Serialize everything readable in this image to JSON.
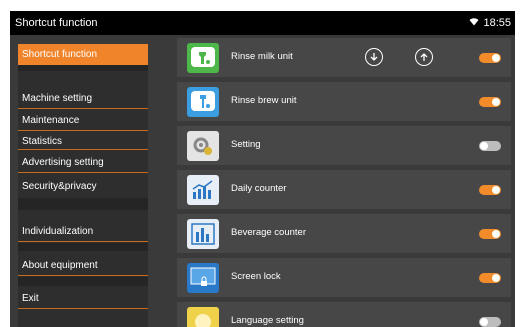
{
  "header": {
    "title": "Shortcut function",
    "time": "18:55",
    "wifi_icon": "wifi-icon"
  },
  "sidebar": {
    "items": [
      {
        "label": "Shortcut function",
        "active": true
      },
      {
        "label": "Machine setting"
      },
      {
        "label": "Maintenance"
      },
      {
        "label": "Statistics"
      },
      {
        "label": "Advertising setting"
      },
      {
        "label": "Security&privacy"
      },
      {
        "label": "Individualization"
      },
      {
        "label": "About equipment"
      },
      {
        "label": "Exit"
      }
    ]
  },
  "list": {
    "move_down_icon": "arrow-down-circle-icon",
    "move_up_icon": "arrow-up-circle-icon",
    "items": [
      {
        "label": "Rinse milk unit",
        "enabled": true,
        "icon": "rinse-milk-icon"
      },
      {
        "label": "Rinse brew unit",
        "enabled": true,
        "icon": "rinse-brew-icon"
      },
      {
        "label": "Setting",
        "enabled": false,
        "icon": "settings-gear-icon"
      },
      {
        "label": "Daily counter",
        "enabled": true,
        "icon": "daily-counter-icon"
      },
      {
        "label": "Beverage counter",
        "enabled": true,
        "icon": "beverage-counter-icon"
      },
      {
        "label": "Screen lock",
        "enabled": true,
        "icon": "screen-lock-icon"
      },
      {
        "label": "Language setting",
        "enabled": false,
        "icon": "language-icon"
      }
    ]
  },
  "colors": {
    "accent": "#f0842b",
    "toggle_on": "#f28c2a",
    "toggle_off": "#bdbdbd"
  }
}
